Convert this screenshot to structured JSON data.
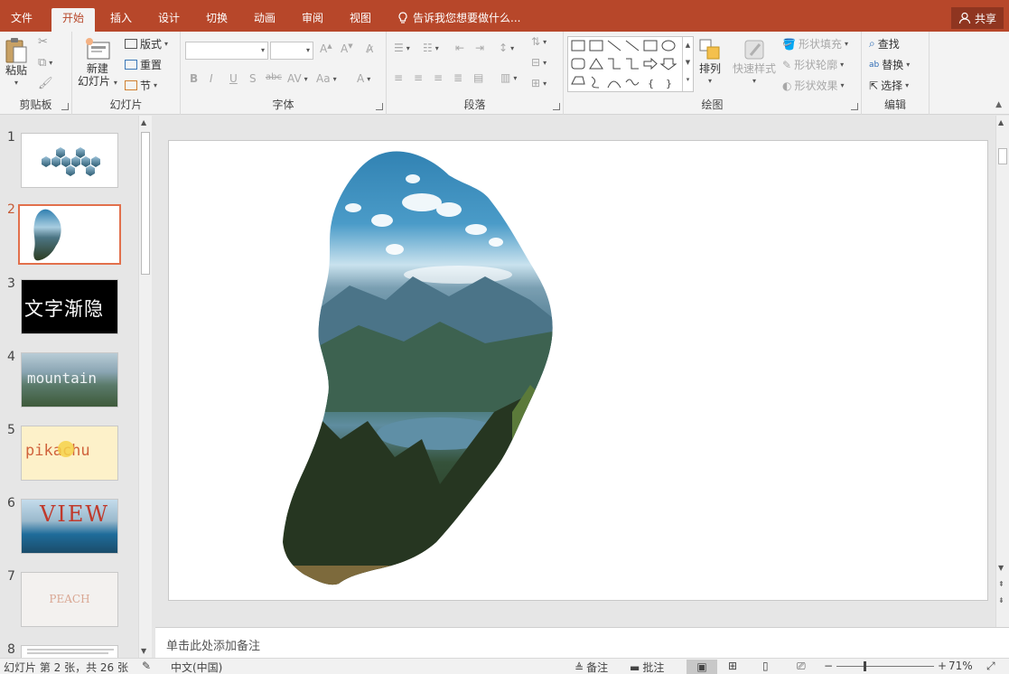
{
  "tabs": [
    {
      "label": "文件",
      "active": false
    },
    {
      "label": "开始",
      "active": true
    },
    {
      "label": "插入",
      "active": false
    },
    {
      "label": "设计",
      "active": false
    },
    {
      "label": "切换",
      "active": false
    },
    {
      "label": "动画",
      "active": false
    },
    {
      "label": "审阅",
      "active": false
    },
    {
      "label": "视图",
      "active": false
    }
  ],
  "tell_me": "告诉我您想要做什么...",
  "share": "共享",
  "ribbon": {
    "clipboard": {
      "label": "剪贴板",
      "paste": "粘贴"
    },
    "slides": {
      "label": "幻灯片",
      "new_slide_1": "新建",
      "new_slide_2": "幻灯片",
      "layout": "版式",
      "reset": "重置",
      "section": "节"
    },
    "font": {
      "label": "字体"
    },
    "paragraph": {
      "label": "段落"
    },
    "drawing": {
      "label": "绘图",
      "arrange": "排列",
      "quick_styles": "快速样式",
      "shape_fill": "形状填充",
      "shape_outline": "形状轮廓",
      "shape_effects": "形状效果"
    },
    "editing": {
      "label": "编辑",
      "find": "查找",
      "replace": "替换",
      "select": "选择"
    }
  },
  "thumbnails": [
    {
      "num": "1",
      "text": ""
    },
    {
      "num": "2",
      "text": ""
    },
    {
      "num": "3",
      "text": "文字渐隐"
    },
    {
      "num": "4",
      "text": "mountain"
    },
    {
      "num": "5",
      "text": "pikachu"
    },
    {
      "num": "6",
      "text": "VIEW"
    },
    {
      "num": "7",
      "text": "PEACH"
    },
    {
      "num": "8",
      "text": ""
    }
  ],
  "active_slide": 2,
  "notes_placeholder": "单击此处添加备注",
  "status": {
    "slide_info": "幻灯片 第 2 张，共 26 张",
    "language": "中文(中国)",
    "notes": "备注",
    "comments": "批注",
    "zoom": "71%"
  },
  "colors": {
    "accent": "#b7472a",
    "thumb_active_border": "#e2704c"
  }
}
